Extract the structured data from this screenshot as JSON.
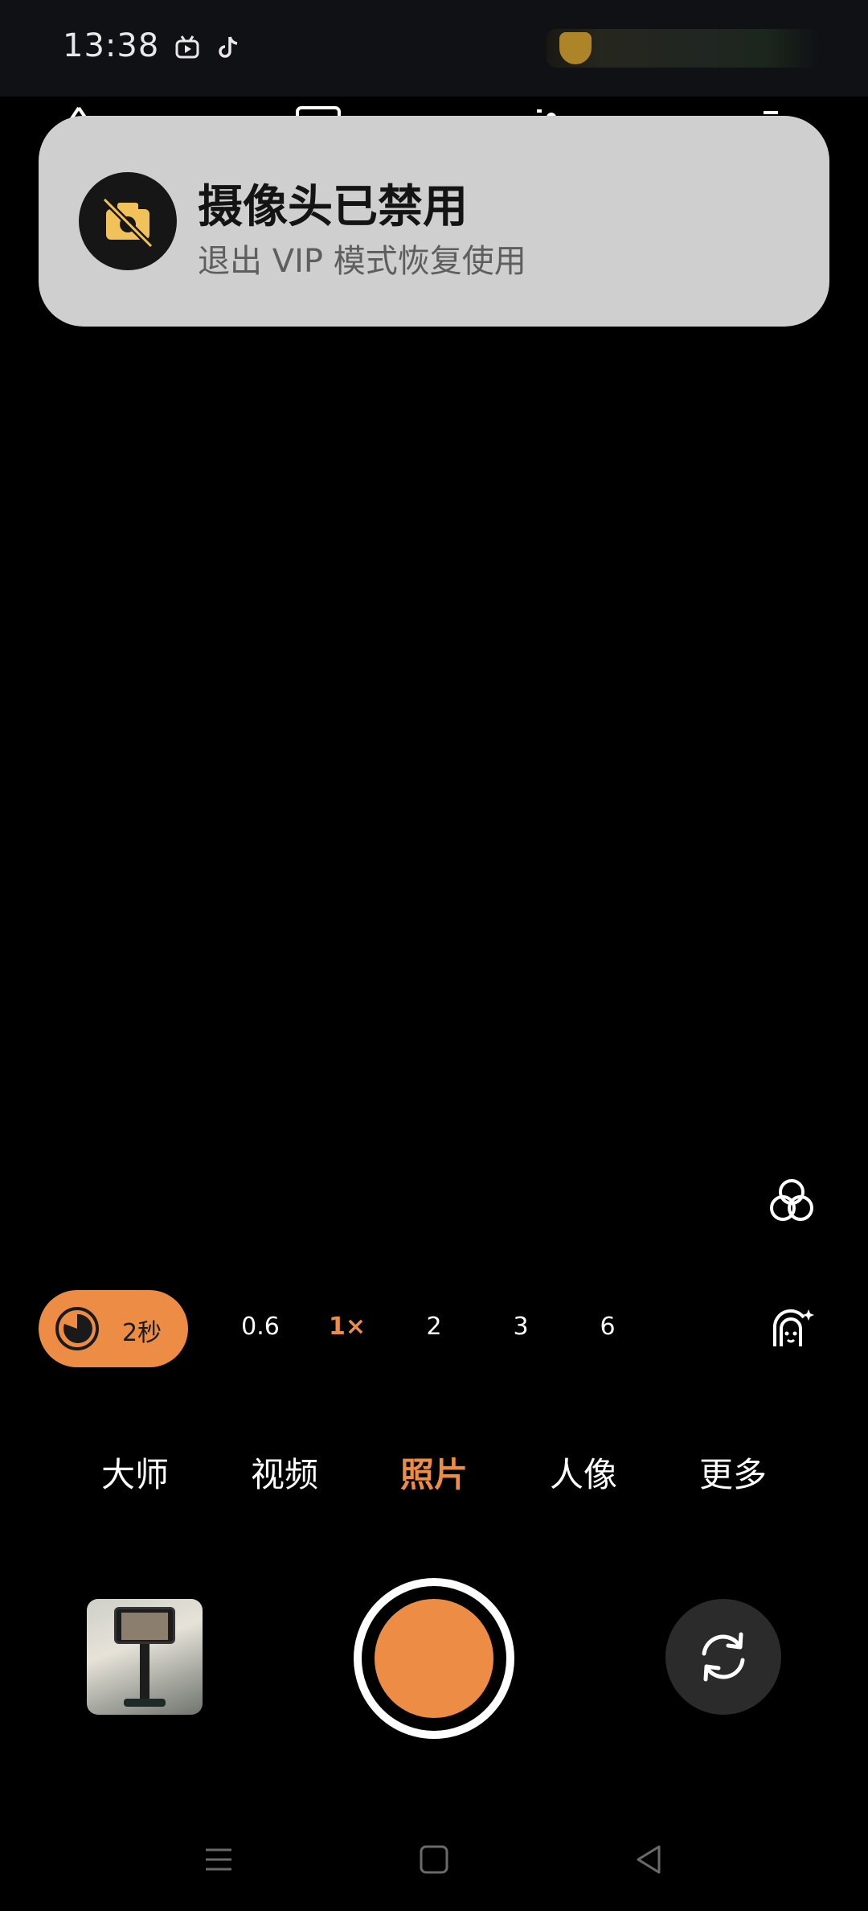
{
  "status_bar": {
    "time": "13:38",
    "icons": [
      "bilibili-icon",
      "tiktok-icon"
    ]
  },
  "notice": {
    "title": "摄像头已禁用",
    "subtitle": "退出 VIP 模式恢复使用",
    "icon": "camera-disabled-icon"
  },
  "zoom": {
    "timer_label": "2秒",
    "options": [
      "0.6",
      "1×",
      "2",
      "3",
      "6"
    ],
    "active": "1×"
  },
  "modes": {
    "items": [
      "大师",
      "视频",
      "照片",
      "人像",
      "更多"
    ],
    "active": "照片"
  },
  "colors": {
    "accent": "#ec8c45",
    "notice_bg": "#cfcfcf",
    "background": "#000000"
  }
}
